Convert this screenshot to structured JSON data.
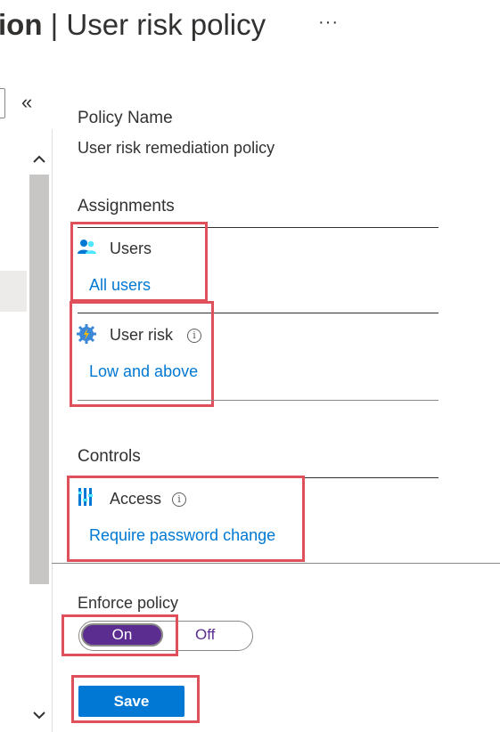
{
  "header": {
    "title_prefix": "ion",
    "title_separator": " | ",
    "title_main": "User risk policy",
    "more_label": "···"
  },
  "left_nav": {
    "collapse_label": "«",
    "scroll_up_label": "⌃",
    "scroll_down_label": "⌄"
  },
  "policy": {
    "name_label": "Policy Name",
    "name_value": "User risk remediation policy"
  },
  "assignments": {
    "heading": "Assignments",
    "users": {
      "icon": "users-icon",
      "label": "Users",
      "value": "All users"
    },
    "user_risk": {
      "icon": "user-risk-icon",
      "label": "User risk",
      "info": "i",
      "value": "Low and above"
    }
  },
  "controls": {
    "heading": "Controls",
    "access": {
      "icon": "access-icon",
      "label": "Access",
      "info": "i",
      "value": "Require password change"
    }
  },
  "enforce": {
    "label": "Enforce policy",
    "on_label": "On",
    "off_label": "Off",
    "selected": "On"
  },
  "actions": {
    "save_label": "Save"
  },
  "colors": {
    "link": "#0078d4",
    "toggle_on": "#5c2d91",
    "save": "#0078d4",
    "highlight": "#e0505a"
  }
}
